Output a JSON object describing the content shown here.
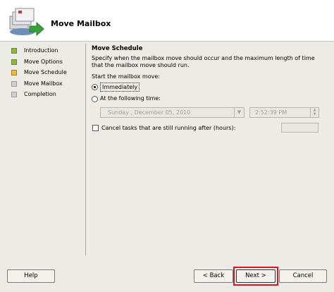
{
  "header": {
    "title": "Move Mailbox",
    "icon": "mailbox-move-icon"
  },
  "nav": {
    "items": [
      {
        "label": "Introduction",
        "status": "done"
      },
      {
        "label": "Move Options",
        "status": "done"
      },
      {
        "label": "Move Schedule",
        "status": "current"
      },
      {
        "label": "Move Mailbox",
        "status": "pending"
      },
      {
        "label": "Completion",
        "status": "pending"
      }
    ]
  },
  "schedule": {
    "title": "Move Schedule",
    "description": "Specify when the mailbox move should occur and the maximum length of time that the mailbox move should run.",
    "start_label": "Start the mailbox move:",
    "immediately_label": "Immediately",
    "at_time_label": "At the following time:",
    "date_value": "Sunday   ,  December 05, 2010",
    "time_value": "2:52:39 PM",
    "cancel_label": "Cancel tasks that are still running after (hours):",
    "hours_value": "",
    "selected_option": "immediately",
    "cancel_checked": false
  },
  "buttons": {
    "help": "Help",
    "back": "< Back",
    "next": "Next >",
    "cancel": "Cancel"
  },
  "colors": {
    "highlight": "#d41b24",
    "done": "#8ab93e",
    "current": "#f0bd3a",
    "pending": "#cfcfcf"
  }
}
